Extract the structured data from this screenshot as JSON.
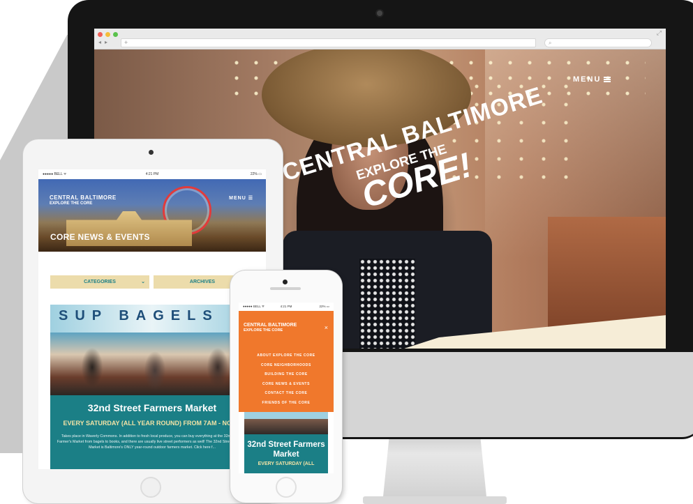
{
  "desktop": {
    "search_placeholder": "⌕",
    "menu_label": "MENU",
    "logo_line1": "CENTRAL BALTIMORE",
    "logo_line2": "EXPLORE THE",
    "logo_line3": "CORE!"
  },
  "tablet": {
    "status": {
      "carrier": "●●●●● BELL ᯤ",
      "time": "4:21 PM",
      "battery": "22% ▭"
    },
    "logo_line1": "CENTRAL BALTIMORE",
    "logo_line2": "EXPLORE THE CORE",
    "menu_label": "MENU ☰",
    "page_title": "CORE NEWS & EVENTS",
    "filters": {
      "categories": "CATEGORIES",
      "archives": "ARCHIVES"
    },
    "event": {
      "title": "32nd Street Farmers Market",
      "schedule": "EVERY SATURDAY (ALL YEAR ROUND) FROM 7AM - NOON",
      "description": "Takes place in Waverly Commons. In addition to fresh local produce, you can buy everything at the 32nd Street Farmer's Market from bagels to books, and there are usually live street performers as well! The 32nd Street Farmers Market is Baltimore's ONLY year-round outdoor farmers market. Click here f..."
    },
    "photo_signs": "SUP BAGELS"
  },
  "phone": {
    "status": {
      "carrier": "●●●●● BELL ᯤ",
      "time": "4:21 PM",
      "battery": "22% ▭"
    },
    "logo_line1": "CENTRAL BALTIMORE",
    "logo_line2": "EXPLORE THE CORE",
    "close_label": "×",
    "menu_items": [
      "ABOUT EXPLORE THE CORE",
      "CORE NEIGHBORHOODS",
      "BUILDING THE CORE",
      "CORE NEWS & EVENTS",
      "CONTACT THE CORE",
      "FRIENDS OF THE CORE"
    ],
    "event": {
      "title": "32nd Street Farmers Market",
      "schedule": "EVERY SATURDAY (ALL"
    }
  }
}
